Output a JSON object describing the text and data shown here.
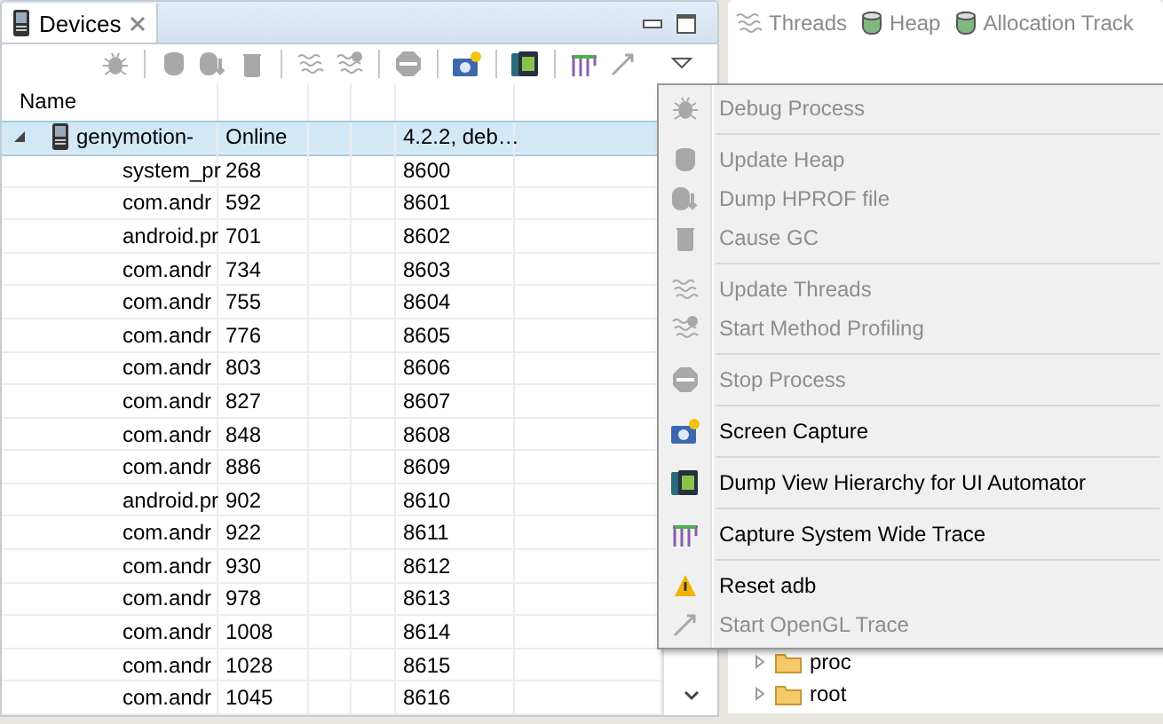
{
  "devices_panel": {
    "tab": {
      "label": "Devices"
    },
    "toolbar": {
      "groups": [
        [
          {
            "disabled": true
          }
        ],
        [
          {
            "disabled": true
          },
          {
            "disabled": true
          },
          {
            "disabled": true
          }
        ],
        [
          {
            "disabled": true
          },
          {
            "disabled": true
          }
        ],
        [
          {
            "disabled": true
          }
        ],
        [
          {
            "disabled": false
          }
        ],
        [
          {
            "disabled": false
          }
        ],
        [
          {
            "disabled": false
          },
          {
            "disabled": true
          }
        ]
      ]
    },
    "table": {
      "columns": [
        "Name"
      ],
      "device": {
        "name": "genymotion-",
        "status": "Online",
        "version": "4.2.2, deb…",
        "expanded": true,
        "selected": true
      },
      "processes": [
        {
          "name": "system_pr",
          "pid": "268",
          "port": "8600"
        },
        {
          "name": "com.andr",
          "pid": "592",
          "port": "8601"
        },
        {
          "name": "android.pr",
          "pid": "701",
          "port": "8602"
        },
        {
          "name": "com.andr",
          "pid": "734",
          "port": "8603"
        },
        {
          "name": "com.andr",
          "pid": "755",
          "port": "8604"
        },
        {
          "name": "com.andr",
          "pid": "776",
          "port": "8605"
        },
        {
          "name": "com.andr",
          "pid": "803",
          "port": "8606"
        },
        {
          "name": "com.andr",
          "pid": "827",
          "port": "8607"
        },
        {
          "name": "com.andr",
          "pid": "848",
          "port": "8608"
        },
        {
          "name": "com.andr",
          "pid": "886",
          "port": "8609"
        },
        {
          "name": "android.pr",
          "pid": "902",
          "port": "8610"
        },
        {
          "name": "com.andr",
          "pid": "922",
          "port": "8611"
        },
        {
          "name": "com.andr",
          "pid": "930",
          "port": "8612"
        },
        {
          "name": "com.andr",
          "pid": "978",
          "port": "8613"
        },
        {
          "name": "com.andr",
          "pid": "1008",
          "port": "8614"
        },
        {
          "name": "com.andr",
          "pid": "1028",
          "port": "8615"
        },
        {
          "name": "com.andr",
          "pid": "1045",
          "port": "8616"
        }
      ]
    }
  },
  "side_panel": {
    "tabs": [
      {
        "label": "Threads"
      },
      {
        "label": "Heap"
      },
      {
        "label": "Allocation Track"
      }
    ],
    "tree": [
      {
        "label": "proc",
        "expanded": false
      },
      {
        "label": "root",
        "expanded": false
      }
    ]
  },
  "menu": {
    "groups": [
      [
        {
          "label": "Debug Process",
          "disabled": true
        }
      ],
      [
        {
          "label": "Update Heap",
          "disabled": true
        },
        {
          "label": "Dump HPROF file",
          "disabled": true
        },
        {
          "label": "Cause GC",
          "disabled": true
        }
      ],
      [
        {
          "label": "Update Threads",
          "disabled": true
        },
        {
          "label": "Start Method Profiling",
          "disabled": true
        }
      ],
      [
        {
          "label": "Stop Process",
          "disabled": true
        }
      ],
      [
        {
          "label": "Screen Capture",
          "disabled": false
        }
      ],
      [
        {
          "label": "Dump View Hierarchy for UI Automator",
          "disabled": false
        }
      ],
      [
        {
          "label": "Capture System Wide Trace",
          "disabled": false
        }
      ],
      [
        {
          "label": "Reset adb",
          "disabled": false
        },
        {
          "label": "Start OpenGL Trace",
          "disabled": true
        }
      ]
    ]
  }
}
